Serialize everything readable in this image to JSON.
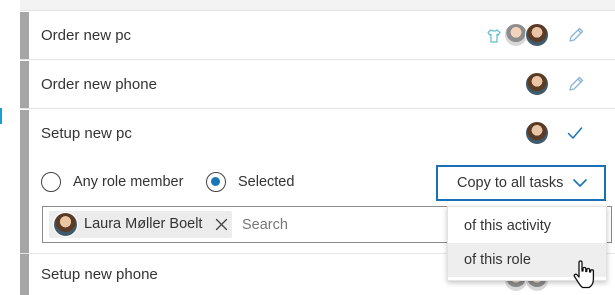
{
  "tasks": [
    {
      "title": "Order new pc",
      "action": "edit"
    },
    {
      "title": "Order new phone",
      "action": "edit"
    },
    {
      "title": "Setup new pc",
      "action": "confirm"
    },
    {
      "title": "Setup new phone"
    }
  ],
  "assignment": {
    "options": [
      "Any role member",
      "Selected"
    ],
    "selected_option": "Selected",
    "copy_button_label": "Copy to all tasks",
    "dropdown_items": [
      "of this activity",
      "of this role"
    ],
    "hovered_item": "of this role",
    "selected_person": "Laura Møller Boelt",
    "search_placeholder": "Search"
  },
  "colors": {
    "accent": "#1a75b8",
    "focus_border": "#1a6fb5",
    "task_stripe": "#a6a6a6",
    "icon_teal": "#5bbfcf"
  }
}
